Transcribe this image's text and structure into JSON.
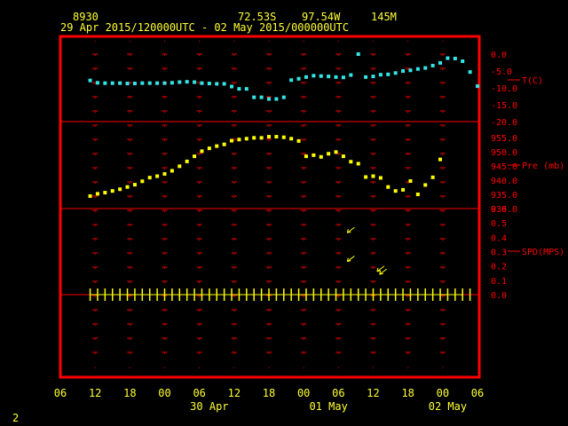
{
  "header": {
    "station_id": "8930",
    "lat": "72.53S",
    "lon": "97.54W",
    "elev": "145M",
    "period": "29 Apr 2015/120000UTC - 02 May 2015/000000UTC"
  },
  "footer": {
    "frame_number": "2"
  },
  "colors": {
    "background": "#000000",
    "frame": "#ff0000",
    "grid": "#ff0000",
    "axis_text": "#ffff33",
    "temperature": "#33e6e6",
    "pressure": "#ffff00",
    "wind": "#ffff00",
    "right_labels": "#ff0000"
  },
  "chart_data": {
    "type": "scatter",
    "time_axis": {
      "tick_labels": [
        "06",
        "12",
        "18",
        "00",
        "06",
        "12",
        "18",
        "00",
        "06",
        "12",
        "18",
        "00",
        "06"
      ],
      "day_labels": [
        {
          "label": "30 Apr",
          "hour": 36
        },
        {
          "label": "01 May",
          "hour": 60
        },
        {
          "label": "02 May",
          "hour": 84
        }
      ],
      "range_hours": [
        6,
        90
      ],
      "unit": "hours since 29 Apr 00 UTC",
      "grid": true
    },
    "panels": [
      {
        "name": "temperature",
        "ylabel": "T(C)",
        "ylim": [
          -20,
          3
        ],
        "tick_labels": [
          "0.0",
          "-5.0",
          "-10.0",
          "-15.0",
          "-20.0"
        ],
        "tick_values": [
          0,
          -5,
          -10,
          -15,
          -20
        ],
        "points": [
          [
            12,
            -7.8
          ],
          [
            13.5,
            -8.5
          ],
          [
            15,
            -8.6
          ],
          [
            16.5,
            -8.6
          ],
          [
            18,
            -8.6
          ],
          [
            19.5,
            -8.7
          ],
          [
            21,
            -8.7
          ],
          [
            22.5,
            -8.6
          ],
          [
            24,
            -8.6
          ],
          [
            25.5,
            -8.6
          ],
          [
            27,
            -8.6
          ],
          [
            28.5,
            -8.5
          ],
          [
            30,
            -8.3
          ],
          [
            31.5,
            -8.2
          ],
          [
            33,
            -8.3
          ],
          [
            34.5,
            -8.6
          ],
          [
            36,
            -8.7
          ],
          [
            37.5,
            -8.8
          ],
          [
            39,
            -8.8
          ],
          [
            40.5,
            -9.6
          ],
          [
            42,
            -10.3
          ],
          [
            43.5,
            -10.3
          ],
          [
            45,
            -12.8
          ],
          [
            46.5,
            -12.8
          ],
          [
            48,
            -13.3
          ],
          [
            49.5,
            -13.3
          ],
          [
            51,
            -12.8
          ],
          [
            52.5,
            -7.7
          ],
          [
            54,
            -7.3
          ],
          [
            55.5,
            -6.8
          ],
          [
            57,
            -6.4
          ],
          [
            58.5,
            -6.5
          ],
          [
            60,
            -6.6
          ],
          [
            61.5,
            -6.8
          ],
          [
            63,
            -6.9
          ],
          [
            64.5,
            -6.2
          ],
          [
            66,
            0
          ],
          [
            67.5,
            -6.8
          ],
          [
            69,
            -6.6
          ],
          [
            70.5,
            -6.1
          ],
          [
            72,
            -6.0
          ],
          [
            73.5,
            -5.6
          ],
          [
            75,
            -5.0
          ],
          [
            76.5,
            -4.8
          ],
          [
            78,
            -4.4
          ],
          [
            79.5,
            -4.1
          ],
          [
            81,
            -3.4
          ],
          [
            82.5,
            -2.6
          ],
          [
            84,
            -1.2
          ],
          [
            85.5,
            -1.3
          ],
          [
            87,
            -2.1
          ],
          [
            88.5,
            -5.3
          ],
          [
            90,
            -9.5
          ]
        ]
      },
      {
        "name": "pressure",
        "ylabel": "Pre (mb)",
        "ylim": [
          930,
          955
        ],
        "tick_labels": [
          "955.0",
          "950.0",
          "945.0",
          "940.0",
          "935.0",
          "930.0"
        ],
        "tick_values": [
          955,
          950,
          945,
          940,
          935,
          930
        ],
        "points": [
          [
            12,
            934.4
          ],
          [
            13.5,
            935.2
          ],
          [
            15,
            935.6
          ],
          [
            16.5,
            936.2
          ],
          [
            18,
            936.8
          ],
          [
            19.5,
            937.6
          ],
          [
            21,
            938.4
          ],
          [
            22.5,
            939.6
          ],
          [
            24,
            940.9
          ],
          [
            25.5,
            941.4
          ],
          [
            27,
            942.2
          ],
          [
            28.5,
            943.3
          ],
          [
            30,
            944.9
          ],
          [
            31.5,
            946.6
          ],
          [
            33,
            948.4
          ],
          [
            34.5,
            950.2
          ],
          [
            36,
            951.2
          ],
          [
            37.5,
            952.0
          ],
          [
            39,
            952.6
          ],
          [
            40.5,
            953.9
          ],
          [
            42,
            954.3
          ],
          [
            43.5,
            954.6
          ],
          [
            45,
            954.9
          ],
          [
            46.5,
            954.9
          ],
          [
            48,
            955.3
          ],
          [
            49.5,
            955.3
          ],
          [
            51,
            955.1
          ],
          [
            52.5,
            954.6
          ],
          [
            54,
            953.8
          ],
          [
            55.5,
            948.4
          ],
          [
            57,
            948.8
          ],
          [
            58.5,
            948.2
          ],
          [
            60,
            949.3
          ],
          [
            61.5,
            949.9
          ],
          [
            63,
            948.4
          ],
          [
            64.5,
            946.5
          ],
          [
            66,
            945.8
          ],
          [
            67.5,
            941.1
          ],
          [
            69,
            941.4
          ],
          [
            70.5,
            940.8
          ],
          [
            72,
            937.6
          ],
          [
            73.5,
            936.2
          ],
          [
            75,
            936.6
          ],
          [
            76.5,
            939.7
          ],
          [
            78,
            935.0
          ],
          [
            79.5,
            938.3
          ],
          [
            81,
            941.0
          ],
          [
            82.5,
            947.3
          ]
        ]
      },
      {
        "name": "wind_speed",
        "ylabel": "SPD(MPS)",
        "ylim": [
          0,
          0.6
        ],
        "tick_labels": [
          "0.6",
          "0.5",
          "0.4",
          "0.3",
          "0.2",
          "0.1",
          "0.0"
        ],
        "tick_values": [
          0.6,
          0.5,
          0.4,
          0.3,
          0.2,
          0.1,
          0.0
        ],
        "arrows": [
          {
            "hour": 64.5,
            "speed": 0.45,
            "toward": "southwest"
          },
          {
            "hour": 64.5,
            "speed": 0.25,
            "toward": "southwest"
          },
          {
            "hour": 70.5,
            "speed": 0.18,
            "toward": "southwest"
          },
          {
            "hour": 71.0,
            "speed": 0.16,
            "toward": "southwest"
          }
        ]
      }
    ],
    "obs_times": [
      12,
      13.5,
      15,
      16.5,
      18,
      19.5,
      21,
      22.5,
      24,
      25.5,
      27,
      28.5,
      30,
      31.5,
      33,
      34.5,
      36,
      37.5,
      39,
      40.5,
      42,
      43.5,
      45,
      46.5,
      48,
      49.5,
      51,
      52.5,
      54,
      55.5,
      57,
      58.5,
      60,
      61.5,
      63,
      64.5,
      66,
      67.5,
      69,
      70.5,
      72,
      73.5,
      75,
      76.5,
      78,
      79.5,
      81,
      82.5,
      84,
      85.5,
      87,
      88.5
    ]
  }
}
